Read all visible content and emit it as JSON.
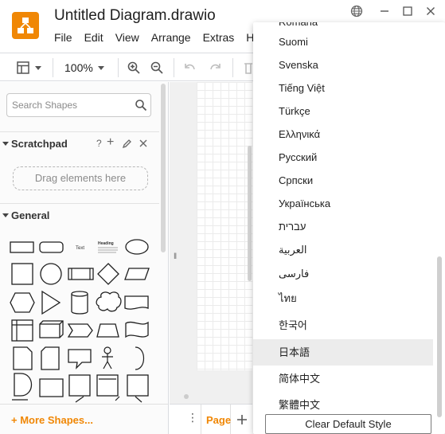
{
  "app": {
    "title": "Untitled Diagram.drawio",
    "logo_color": "#f08705"
  },
  "menu": [
    "File",
    "Edit",
    "View",
    "Arrange",
    "Extras",
    "H"
  ],
  "window_controls": [
    "globe-icon",
    "minimize-icon",
    "maximize-icon",
    "close-icon"
  ],
  "toolbar": {
    "zoom": "100%"
  },
  "sidebar": {
    "search_placeholder": "Search Shapes",
    "scratchpad": {
      "title": "Scratchpad",
      "actions": [
        "?",
        "+",
        "edit",
        "close"
      ],
      "drag_hint": "Drag elements here"
    },
    "general": {
      "title": "General"
    },
    "more_shapes": "+ More Shapes..."
  },
  "footer": {
    "page_tab": "Page"
  },
  "language_menu": {
    "partial_top": "Română",
    "items": [
      "Suomi",
      "Svenska",
      "Tiếng Việt",
      "Türkçe",
      "Ελληνικά",
      "Русский",
      "Српски",
      "Українська",
      "עברית",
      "العربية",
      "فارسی",
      "ไทย",
      "한국어",
      "日本語",
      "简体中文",
      "繁體中文"
    ],
    "selected": "日本語",
    "button": "Clear Default Style"
  }
}
